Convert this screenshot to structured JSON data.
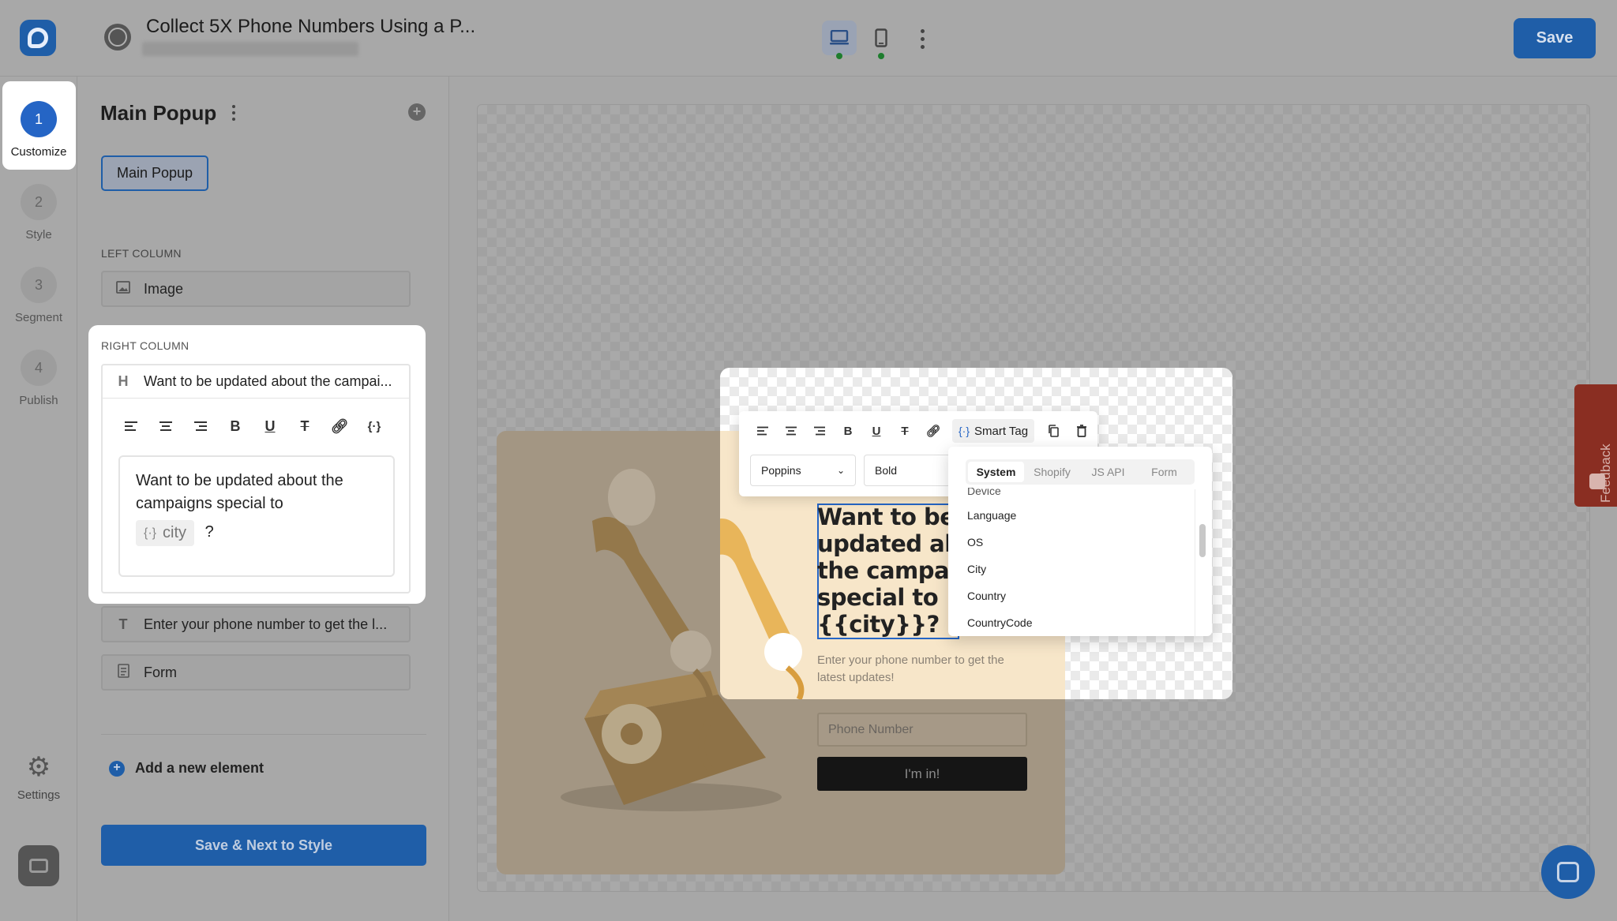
{
  "header": {
    "title": "Collect 5X Phone Numbers Using a P...",
    "save_label": "Save",
    "view_desktop_icon": "laptop-icon",
    "view_mobile_icon": "mobile-icon"
  },
  "rail": {
    "steps": [
      {
        "number": "1",
        "label": "Customize",
        "active": true
      },
      {
        "number": "2",
        "label": "Style",
        "active": false
      },
      {
        "number": "3",
        "label": "Segment",
        "active": false
      },
      {
        "number": "4",
        "label": "Publish",
        "active": false
      }
    ],
    "settings_label": "Settings"
  },
  "panel": {
    "title": "Main Popup",
    "chip": "Main Popup",
    "left_column_label": "LEFT COLUMN",
    "left_items": [
      {
        "icon": "image-icon",
        "label": "Image"
      }
    ],
    "right_column_label": "RIGHT COLUMN",
    "heading_item": "Want to be updated about the campai...",
    "editor_text": "Want to be updated about the campaigns special to",
    "editor_tag": "city",
    "editor_suffix": "?",
    "text_item": "Enter your phone number to get the l...",
    "form_item": "Form",
    "add_element": "Add a new element",
    "save_next": "Save & Next to Style"
  },
  "toolbar": {
    "smart_tag": "Smart Tag",
    "font": "Poppins",
    "weight": "Bold"
  },
  "smart_tag_dropdown": {
    "tabs": [
      "System",
      "Shopify",
      "JS API",
      "Form"
    ],
    "active_tab": "System",
    "items": [
      "Device",
      "Language",
      "OS",
      "City",
      "Country",
      "CountryCode"
    ]
  },
  "popup": {
    "headline": "Want to be updated ab the campai special to {{city}}?",
    "headline_lines": [
      "Want to be",
      "updated ab",
      "the campai",
      "special to",
      "{{city}}?"
    ],
    "subtext": "Enter your phone number to get the latest updates!",
    "phone_placeholder": "Phone Number",
    "cta": "I'm in!"
  },
  "feedback_label": "Feedback",
  "colors": {
    "primary": "#2565c5",
    "popup_bg": "#f7e6c9",
    "cta_bg": "#151515",
    "feedback_bg": "#c0392b"
  }
}
